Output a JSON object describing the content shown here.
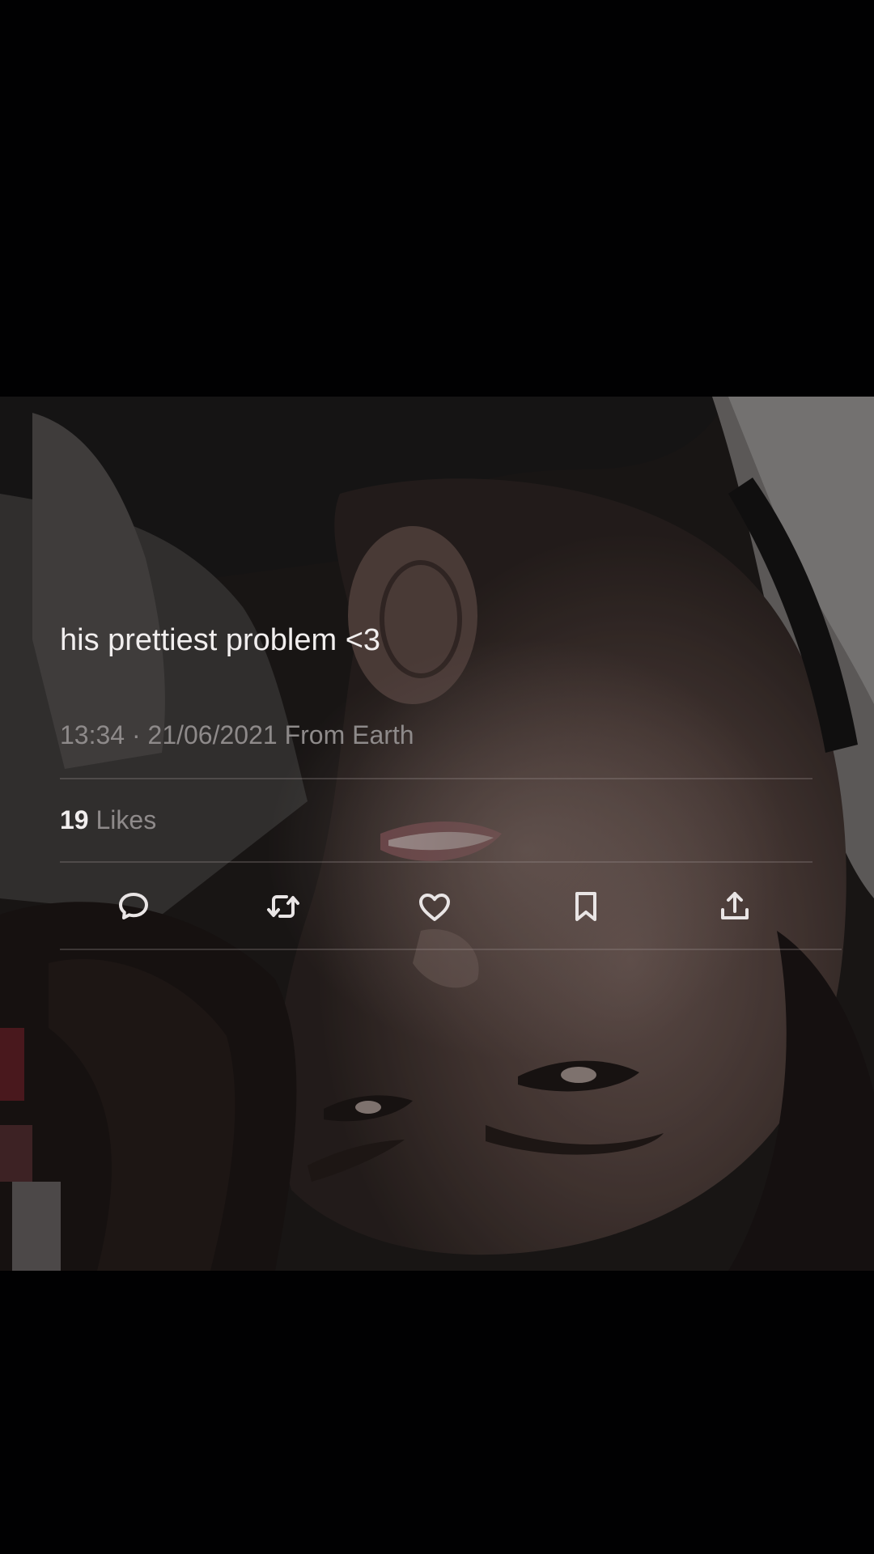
{
  "tweet": {
    "text": "his prettiest problem <3",
    "time": "13:34",
    "separator": "·",
    "date": "21/06/2021",
    "source": "From Earth",
    "likes_count": "19",
    "likes_label": "Likes"
  },
  "actions": [
    {
      "name": "reply",
      "icon": "comment-icon"
    },
    {
      "name": "retweet",
      "icon": "retweet-icon"
    },
    {
      "name": "like",
      "icon": "heart-icon"
    },
    {
      "name": "bookmark",
      "icon": "bookmark-icon"
    },
    {
      "name": "share",
      "icon": "share-icon"
    }
  ],
  "colors": {
    "background": "#010102",
    "text_primary": "#f1eeee",
    "text_secondary": "#8e8a8a",
    "icon": "#e9e5e5"
  }
}
